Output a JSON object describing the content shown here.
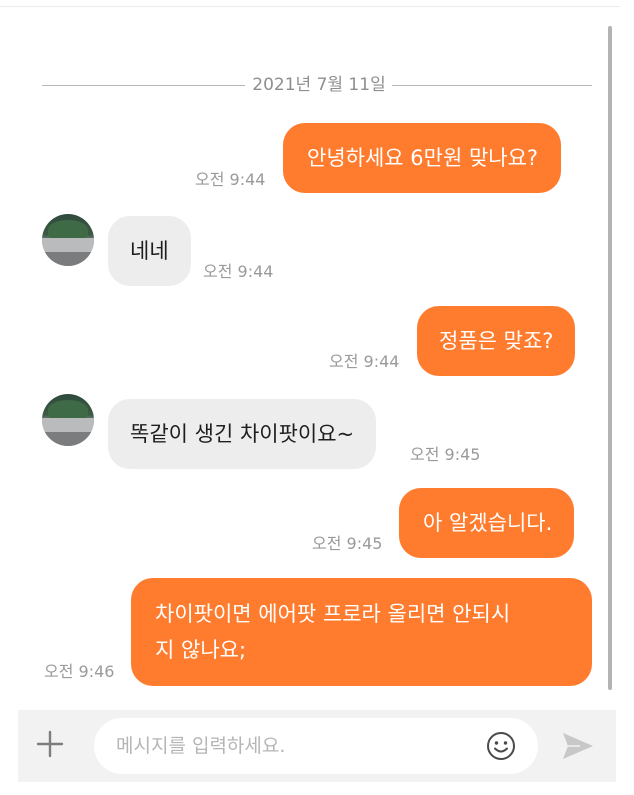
{
  "chat": {
    "date": "2021년 7월 11일",
    "messages": [
      {
        "side": "out",
        "text": "안녕하세요 6만원 맞나요?",
        "time": "오전 9:44"
      },
      {
        "side": "in",
        "text": "네네",
        "time": "오전 9:44"
      },
      {
        "side": "out",
        "text": "정품은 맞죠?",
        "time": "오전 9:44"
      },
      {
        "side": "in",
        "text": "똑같이 생긴 차이팟이요~",
        "time": "오전 9:45"
      },
      {
        "side": "out",
        "text": "아 알겠습니다.",
        "time": "오전 9:45"
      },
      {
        "side": "out",
        "lines": [
          "차이팟이면 에어팟 프로라 올리면 안되시",
          "지 않나요;"
        ],
        "time": "오전 9:46"
      }
    ]
  },
  "composer": {
    "placeholder": "메시지를 입력하세요.",
    "value": "",
    "add_icon": "plus-icon",
    "emoji_icon": "smiley-icon",
    "send_icon": "send-arrow-icon"
  },
  "colors": {
    "outgoing_bubble": "#ff7b2e",
    "incoming_bubble": "#ededed",
    "timestamp": "#9a9a9a",
    "input_bar": "#f2f2f2"
  }
}
